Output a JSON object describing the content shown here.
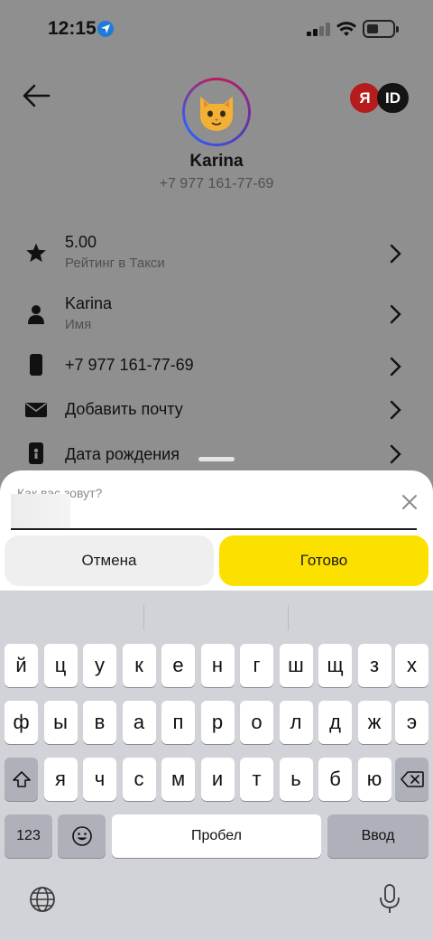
{
  "status_bar": {
    "time": "12:15"
  },
  "header": {
    "yandex_letter": "Я",
    "id_label": "ID",
    "avatar_emoji": "🐱"
  },
  "profile": {
    "name": "Karina",
    "phone": "+7 977 161-77-69"
  },
  "rows": [
    {
      "title": "5.00",
      "subtitle": "Рейтинг в Такси",
      "icon": "star-icon"
    },
    {
      "title": "Karina",
      "subtitle": "Имя",
      "icon": "person-icon"
    },
    {
      "title": "+7 977 161-77-69",
      "icon": "phone-icon"
    },
    {
      "title": "Добавить почту",
      "icon": "mail-icon"
    },
    {
      "title": "Дата рождения",
      "icon": "calendar-icon"
    }
  ],
  "sheet": {
    "field_label": "Как вас зовут?",
    "field_value": "",
    "cancel_label": "Отмена",
    "done_label": "Готово"
  },
  "keyboard": {
    "row1": [
      "й",
      "ц",
      "у",
      "к",
      "е",
      "н",
      "г",
      "ш",
      "щ",
      "з",
      "х"
    ],
    "row2": [
      "ф",
      "ы",
      "в",
      "а",
      "п",
      "р",
      "о",
      "л",
      "д",
      "ж",
      "э"
    ],
    "row3": [
      "я",
      "ч",
      "с",
      "м",
      "и",
      "т",
      "ь",
      "б",
      "ю"
    ],
    "numbers_label": "123",
    "space_label": "Пробел",
    "return_label": "Ввод"
  },
  "colors": {
    "accent": "#fce000",
    "dim_background": "#8f8f8f",
    "keyboard_bg": "#d2d3d8"
  }
}
